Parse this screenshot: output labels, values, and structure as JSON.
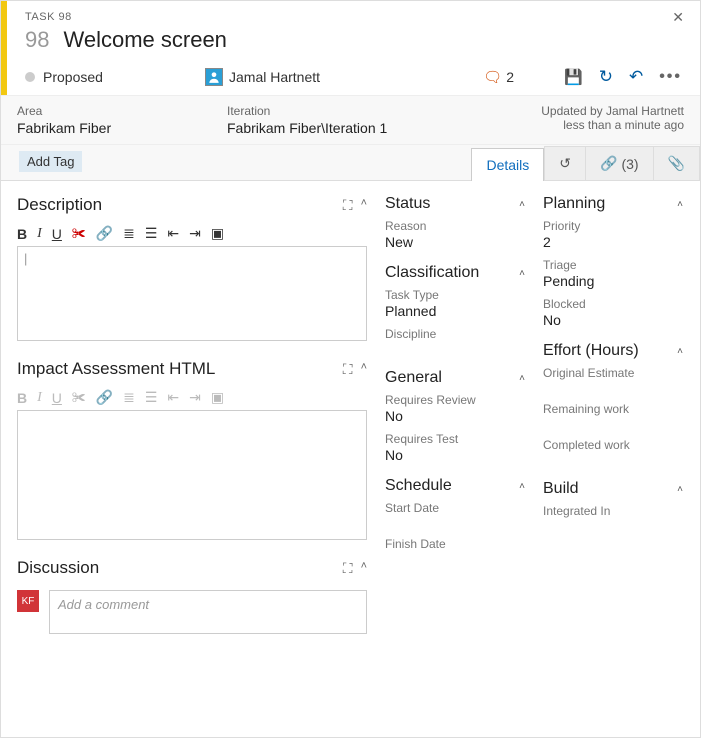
{
  "header": {
    "task_label": "TASK 98",
    "id": "98",
    "title": "Welcome screen"
  },
  "state": "Proposed",
  "assignee": "Jamal Hartnett",
  "comments_count": "2",
  "info": {
    "area_label": "Area",
    "area_value": "Fabrikam Fiber",
    "iteration_label": "Iteration",
    "iteration_value": "Fabrikam Fiber\\Iteration 1",
    "updated_by": "Updated by Jamal Hartnett",
    "updated_when": "less than a minute ago"
  },
  "add_tag_label": "Add Tag",
  "tabs": {
    "details": "Details",
    "links_count": "(3)"
  },
  "left": {
    "description_title": "Description",
    "impact_title": "Impact Assessment HTML",
    "discussion_title": "Discussion",
    "discussion_placeholder": "Add a comment",
    "discussion_avatar_initials": "KF",
    "editor_caret": "|"
  },
  "mid": {
    "status": {
      "title": "Status",
      "reason_label": "Reason",
      "reason_value": "New"
    },
    "classification": {
      "title": "Classification",
      "task_type_label": "Task Type",
      "task_type_value": "Planned",
      "discipline_label": "Discipline"
    },
    "general": {
      "title": "General",
      "req_review_label": "Requires Review",
      "req_review_value": "No",
      "req_test_label": "Requires Test",
      "req_test_value": "No"
    },
    "schedule": {
      "title": "Schedule",
      "start_label": "Start Date",
      "finish_label": "Finish Date"
    }
  },
  "right": {
    "planning": {
      "title": "Planning",
      "priority_label": "Priority",
      "priority_value": "2",
      "triage_label": "Triage",
      "triage_value": "Pending",
      "blocked_label": "Blocked",
      "blocked_value": "No"
    },
    "effort": {
      "title": "Effort (Hours)",
      "orig_label": "Original Estimate",
      "remaining_label": "Remaining work",
      "completed_label": "Completed work"
    },
    "build": {
      "title": "Build",
      "integrated_label": "Integrated In"
    }
  }
}
